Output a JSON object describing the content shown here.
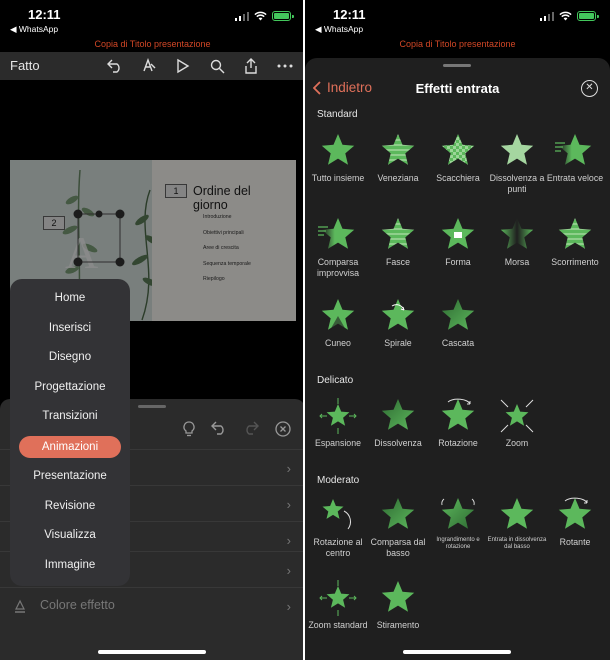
{
  "status": {
    "time": "12:11",
    "back_app": "◀ WhatsApp"
  },
  "document_title": "Copia di Titolo presentazione",
  "left": {
    "toolbar": {
      "done": "Fatto"
    },
    "slide": {
      "title": "Ordine del giorno",
      "items": [
        "Introduzione",
        "Obiettivi principali",
        "Aree di crescita",
        "Sequenza temporale",
        "Riepilogo"
      ],
      "box1": "1",
      "box2": "2"
    },
    "menu": {
      "items": [
        "Home",
        "Inserisci",
        "Disegno",
        "Progettazione",
        "Transizioni",
        "Animazioni",
        "Presentazione",
        "Revisione",
        "Visualizza",
        "Immagine"
      ],
      "selected": "Animazioni"
    },
    "panel": {
      "color_effect": "Colore effetto"
    }
  },
  "right": {
    "back": "Indietro",
    "title": "Effetti entrata",
    "accent": "#5cb85c",
    "sections": [
      {
        "name": "Standard",
        "items": [
          "Tutto insieme",
          "Veneziana",
          "Scacchiera",
          "Dissolvenza a punti",
          "Entrata veloce",
          "Comparsa improvvisa",
          "Fasce",
          "Forma",
          "Morsa",
          "Scorrimento",
          "Cuneo",
          "Spirale",
          "Cascata"
        ]
      },
      {
        "name": "Delicato",
        "items": [
          "Espansione",
          "Dissolvenza",
          "Rotazione",
          "Zoom"
        ]
      },
      {
        "name": "Moderato",
        "items": [
          "Rotazione al centro",
          "Comparsa dal basso",
          "Ingrandimento e rotazione",
          "Entrata in dissolvenza dal basso",
          "Rotante",
          "Zoom standard",
          "Stiramento"
        ]
      }
    ]
  }
}
